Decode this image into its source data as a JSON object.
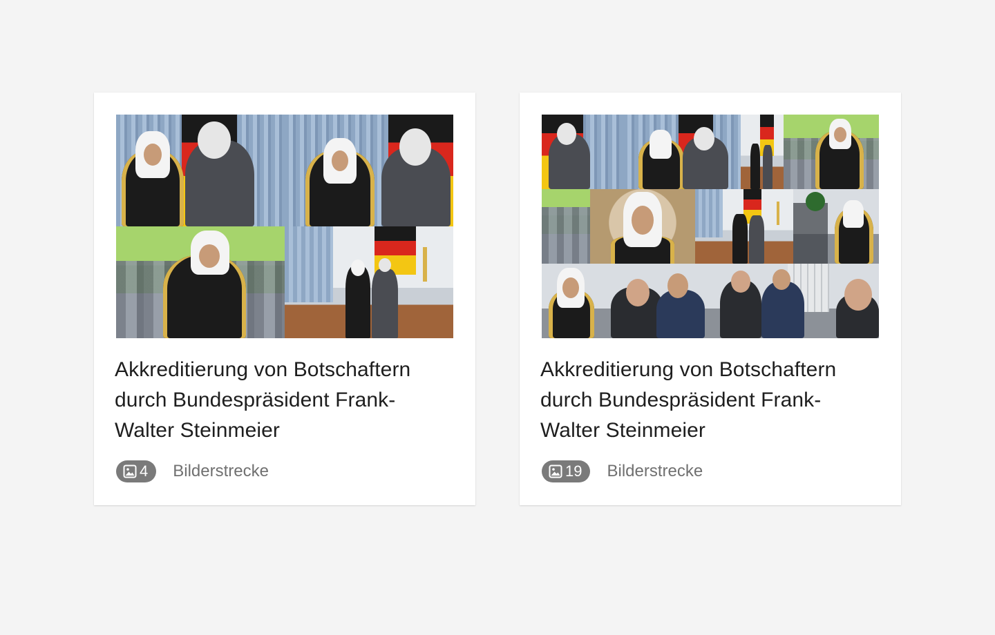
{
  "cards": [
    {
      "title": "Akkreditierung von Botschaftern durch Bundespräsident Frank-Walter Steinmeier",
      "count": "4",
      "type_label": "Bilderstrecke",
      "icon": "image-icon"
    },
    {
      "title": "Akkreditierung von Botschaftern durch Bundespräsident Frank-Walter Steinmeier",
      "count": "19",
      "type_label": "Bilderstrecke",
      "icon": "image-icon"
    }
  ],
  "colors": {
    "background": "#f4f4f4",
    "card": "#ffffff",
    "badge": "#7a7a7a",
    "title_text": "#1e1e1e",
    "meta_text": "#707070"
  }
}
